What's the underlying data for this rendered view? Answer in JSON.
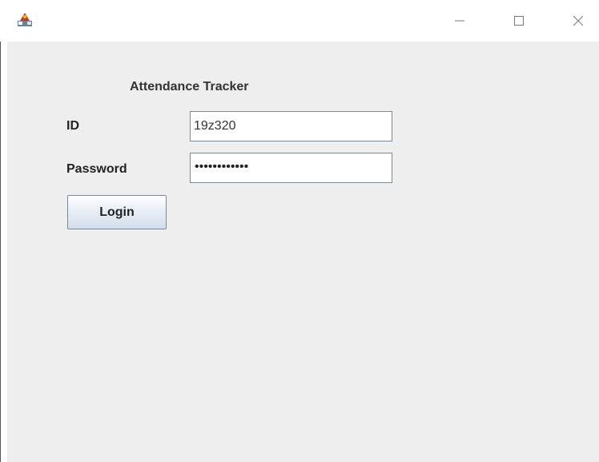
{
  "window": {
    "icon": "java-app-icon",
    "controls": {
      "minimize_icon": "minimize-icon",
      "maximize_icon": "maximize-icon",
      "close_icon": "close-icon"
    }
  },
  "form": {
    "heading": "Attendance Tracker",
    "id_label": "ID",
    "id_value": "19z320",
    "password_label": "Password",
    "password_mask": "••••••••••••",
    "login_label": "Login"
  },
  "colors": {
    "content_bg": "#eeeeee",
    "field_border": "#7a8a99",
    "button_gradient_bottom": "#d3deeb"
  }
}
